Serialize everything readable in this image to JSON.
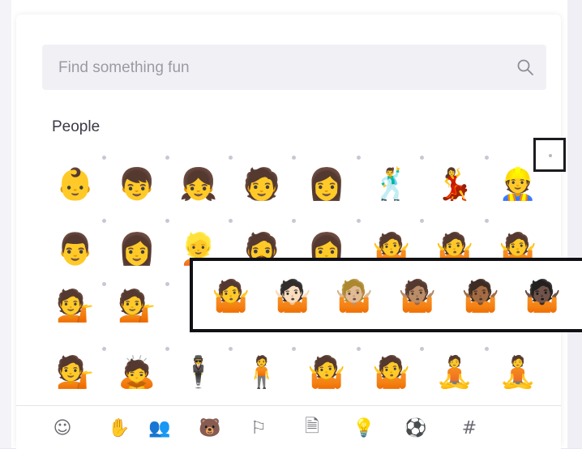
{
  "search": {
    "placeholder": "Find something fun"
  },
  "section": {
    "title": "People"
  },
  "emoji_rows": [
    [
      "👶",
      "👦",
      "👧",
      "🧑",
      "👩",
      "🕺",
      "💃",
      "👷"
    ],
    [
      "👨",
      "👩",
      "👱",
      "🧔",
      "👩",
      "🤷",
      "🤷",
      "🤷"
    ],
    [
      "💁",
      "💁",
      "",
      "",
      "",
      "",
      "",
      ""
    ],
    [
      "💁",
      "🙇",
      "🕴️",
      "🧍",
      "🤷",
      "🤷",
      "🧘",
      "🧘"
    ]
  ],
  "variant_popup": {
    "items": [
      "🤷",
      "🤷🏻",
      "🤷🏼",
      "🤷🏽",
      "🤷🏾",
      "🤷🏿"
    ]
  },
  "categories": [
    {
      "name": "smileys",
      "glyph": "☺",
      "active": false
    },
    {
      "name": "hand",
      "glyph": "✋",
      "active": false
    },
    {
      "name": "people",
      "glyph": "👥",
      "active": true
    },
    {
      "name": "animals",
      "glyph": "🐻",
      "active": false
    },
    {
      "name": "flags",
      "glyph": "⚐",
      "active": false
    },
    {
      "name": "objects",
      "glyph": "🗎",
      "active": false
    },
    {
      "name": "lightbulb",
      "glyph": "💡",
      "active": false
    },
    {
      "name": "sports",
      "glyph": "⚽",
      "active": false
    },
    {
      "name": "symbols",
      "glyph": "#",
      "active": false
    }
  ]
}
